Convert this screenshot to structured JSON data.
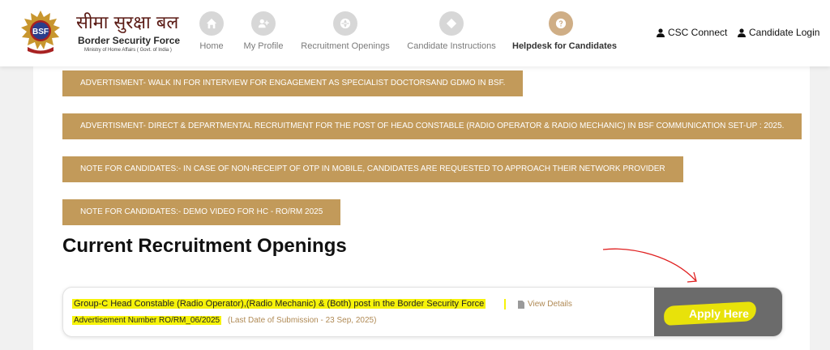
{
  "header": {
    "logo": {
      "hindi_title": "सीमा सुरक्षा बल",
      "english_title": "Border Security Force",
      "ministry": "Ministry of Home Affairs ( Govt. of India )",
      "emblem_text": "BSF"
    },
    "nav": [
      {
        "label": "Home",
        "icon": "home-icon"
      },
      {
        "label": "My Profile",
        "icon": "user-plus-icon"
      },
      {
        "label": "Recruitment Openings",
        "icon": "globe-icon"
      },
      {
        "label": "Candidate Instructions",
        "icon": "diamond-icon"
      },
      {
        "label": "Helpdesk for Candidates",
        "icon": "help-icon",
        "active": true
      }
    ],
    "csc_connect": "CSC Connect",
    "candidate_login": "Candidate Login"
  },
  "notices": [
    "ADVERTISMENT- WALK IN FOR INTERVIEW FOR ENGAGEMENT AS SPECIALIST DOCTORSAND GDMO IN BSF.",
    "ADVERTISMENT- DIRECT & DEPARTMENTAL RECRUITMENT FOR THE POST OF HEAD CONSTABLE (RADIO OPERATOR & RADIO MECHANIC) IN BSF COMMUNICATION SET-UP : 2025.",
    "NOTE FOR CANDIDATES:- IN CASE OF NON-RECEIPT OF OTP IN MOBILE, CANDIDATES ARE REQUESTED TO APPROACH THEIR NETWORK PROVIDER",
    "NOTE FOR CANDIDATES:- DEMO VIDEO FOR HC - RO/RM 2025"
  ],
  "openings": {
    "heading": "Current Recruitment Openings",
    "items": [
      {
        "title": "Group-C Head Constable (Radio Operator),(Radio Mechanic) & (Both) post in the Border Security Force",
        "view_details": "View Details",
        "advertisement": "Advertisement Number RO/RM_06/2025",
        "last_date": "(Last Date of Submission - 23 Sep, 2025)",
        "apply_label": "Apply Here"
      }
    ]
  },
  "colors": {
    "accent": "#c29a5a",
    "highlight": "#f6f30a",
    "annotation_arrow": "#e02020",
    "apply_bg": "#6b6b6b"
  }
}
